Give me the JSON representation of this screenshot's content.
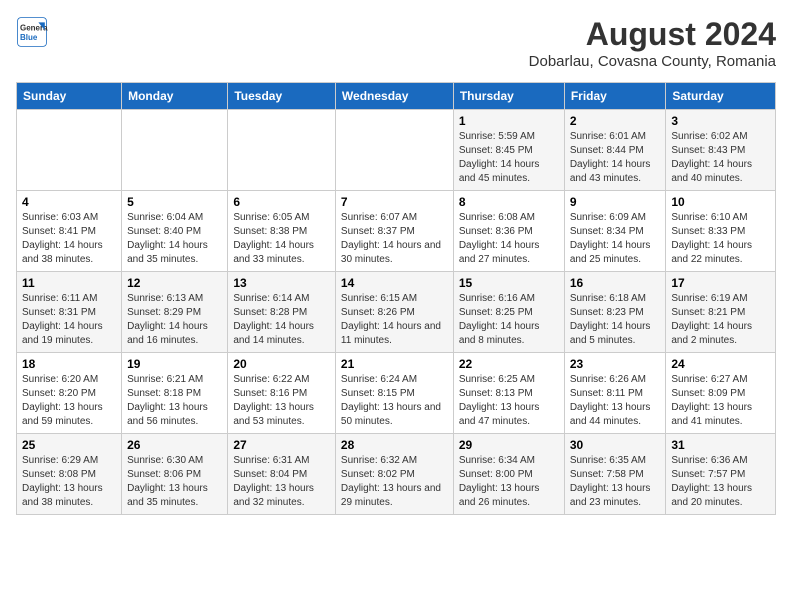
{
  "logo": {
    "line1": "General",
    "line2": "Blue"
  },
  "title": "August 2024",
  "subtitle": "Dobarlau, Covasna County, Romania",
  "weekdays": [
    "Sunday",
    "Monday",
    "Tuesday",
    "Wednesday",
    "Thursday",
    "Friday",
    "Saturday"
  ],
  "weeks": [
    [
      {
        "day": "",
        "info": ""
      },
      {
        "day": "",
        "info": ""
      },
      {
        "day": "",
        "info": ""
      },
      {
        "day": "",
        "info": ""
      },
      {
        "day": "1",
        "info": "Sunrise: 5:59 AM\nSunset: 8:45 PM\nDaylight: 14 hours and 45 minutes."
      },
      {
        "day": "2",
        "info": "Sunrise: 6:01 AM\nSunset: 8:44 PM\nDaylight: 14 hours and 43 minutes."
      },
      {
        "day": "3",
        "info": "Sunrise: 6:02 AM\nSunset: 8:43 PM\nDaylight: 14 hours and 40 minutes."
      }
    ],
    [
      {
        "day": "4",
        "info": "Sunrise: 6:03 AM\nSunset: 8:41 PM\nDaylight: 14 hours and 38 minutes."
      },
      {
        "day": "5",
        "info": "Sunrise: 6:04 AM\nSunset: 8:40 PM\nDaylight: 14 hours and 35 minutes."
      },
      {
        "day": "6",
        "info": "Sunrise: 6:05 AM\nSunset: 8:38 PM\nDaylight: 14 hours and 33 minutes."
      },
      {
        "day": "7",
        "info": "Sunrise: 6:07 AM\nSunset: 8:37 PM\nDaylight: 14 hours and 30 minutes."
      },
      {
        "day": "8",
        "info": "Sunrise: 6:08 AM\nSunset: 8:36 PM\nDaylight: 14 hours and 27 minutes."
      },
      {
        "day": "9",
        "info": "Sunrise: 6:09 AM\nSunset: 8:34 PM\nDaylight: 14 hours and 25 minutes."
      },
      {
        "day": "10",
        "info": "Sunrise: 6:10 AM\nSunset: 8:33 PM\nDaylight: 14 hours and 22 minutes."
      }
    ],
    [
      {
        "day": "11",
        "info": "Sunrise: 6:11 AM\nSunset: 8:31 PM\nDaylight: 14 hours and 19 minutes."
      },
      {
        "day": "12",
        "info": "Sunrise: 6:13 AM\nSunset: 8:29 PM\nDaylight: 14 hours and 16 minutes."
      },
      {
        "day": "13",
        "info": "Sunrise: 6:14 AM\nSunset: 8:28 PM\nDaylight: 14 hours and 14 minutes."
      },
      {
        "day": "14",
        "info": "Sunrise: 6:15 AM\nSunset: 8:26 PM\nDaylight: 14 hours and 11 minutes."
      },
      {
        "day": "15",
        "info": "Sunrise: 6:16 AM\nSunset: 8:25 PM\nDaylight: 14 hours and 8 minutes."
      },
      {
        "day": "16",
        "info": "Sunrise: 6:18 AM\nSunset: 8:23 PM\nDaylight: 14 hours and 5 minutes."
      },
      {
        "day": "17",
        "info": "Sunrise: 6:19 AM\nSunset: 8:21 PM\nDaylight: 14 hours and 2 minutes."
      }
    ],
    [
      {
        "day": "18",
        "info": "Sunrise: 6:20 AM\nSunset: 8:20 PM\nDaylight: 13 hours and 59 minutes."
      },
      {
        "day": "19",
        "info": "Sunrise: 6:21 AM\nSunset: 8:18 PM\nDaylight: 13 hours and 56 minutes."
      },
      {
        "day": "20",
        "info": "Sunrise: 6:22 AM\nSunset: 8:16 PM\nDaylight: 13 hours and 53 minutes."
      },
      {
        "day": "21",
        "info": "Sunrise: 6:24 AM\nSunset: 8:15 PM\nDaylight: 13 hours and 50 minutes."
      },
      {
        "day": "22",
        "info": "Sunrise: 6:25 AM\nSunset: 8:13 PM\nDaylight: 13 hours and 47 minutes."
      },
      {
        "day": "23",
        "info": "Sunrise: 6:26 AM\nSunset: 8:11 PM\nDaylight: 13 hours and 44 minutes."
      },
      {
        "day": "24",
        "info": "Sunrise: 6:27 AM\nSunset: 8:09 PM\nDaylight: 13 hours and 41 minutes."
      }
    ],
    [
      {
        "day": "25",
        "info": "Sunrise: 6:29 AM\nSunset: 8:08 PM\nDaylight: 13 hours and 38 minutes."
      },
      {
        "day": "26",
        "info": "Sunrise: 6:30 AM\nSunset: 8:06 PM\nDaylight: 13 hours and 35 minutes."
      },
      {
        "day": "27",
        "info": "Sunrise: 6:31 AM\nSunset: 8:04 PM\nDaylight: 13 hours and 32 minutes."
      },
      {
        "day": "28",
        "info": "Sunrise: 6:32 AM\nSunset: 8:02 PM\nDaylight: 13 hours and 29 minutes."
      },
      {
        "day": "29",
        "info": "Sunrise: 6:34 AM\nSunset: 8:00 PM\nDaylight: 13 hours and 26 minutes."
      },
      {
        "day": "30",
        "info": "Sunrise: 6:35 AM\nSunset: 7:58 PM\nDaylight: 13 hours and 23 minutes."
      },
      {
        "day": "31",
        "info": "Sunrise: 6:36 AM\nSunset: 7:57 PM\nDaylight: 13 hours and 20 minutes."
      }
    ]
  ]
}
